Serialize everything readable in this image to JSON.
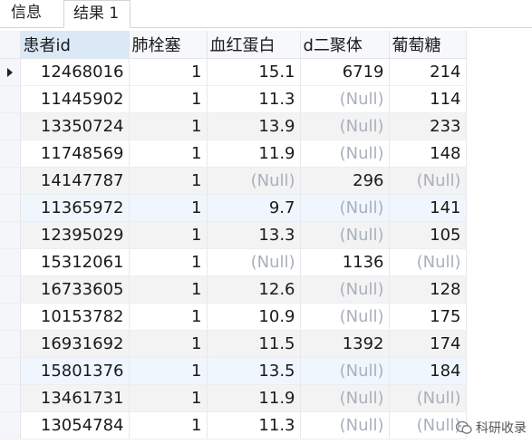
{
  "tabs": [
    "信息",
    "结果 1"
  ],
  "columns": [
    "患者id",
    "肺栓塞",
    "血红蛋白",
    "d二聚体",
    "葡萄糖"
  ],
  "rows": [
    [
      "12468016",
      "1",
      "15.1",
      "6719",
      "214"
    ],
    [
      "11445902",
      "1",
      "11.3",
      "(Null)",
      "114"
    ],
    [
      "13350724",
      "1",
      "13.9",
      "(Null)",
      "233"
    ],
    [
      "11748569",
      "1",
      "11.9",
      "(Null)",
      "148"
    ],
    [
      "14147787",
      "1",
      "(Null)",
      "296",
      "(Null)"
    ],
    [
      "11365972",
      "1",
      "9.7",
      "(Null)",
      "141"
    ],
    [
      "12395029",
      "1",
      "13.3",
      "(Null)",
      "105"
    ],
    [
      "15312061",
      "1",
      "(Null)",
      "1136",
      "(Null)"
    ],
    [
      "16733605",
      "1",
      "12.6",
      "(Null)",
      "128"
    ],
    [
      "10153782",
      "1",
      "10.9",
      "(Null)",
      "175"
    ],
    [
      "16931692",
      "1",
      "11.5",
      "1392",
      "174"
    ],
    [
      "15801376",
      "1",
      "13.5",
      "(Null)",
      "184"
    ],
    [
      "13461731",
      "1",
      "11.9",
      "(Null)",
      "(Null)"
    ],
    [
      "13054784",
      "1",
      "11.3",
      "(Null)",
      "(Null)"
    ]
  ],
  "watermark": "科研收录",
  "colors": {
    "null_text": "#a9b0bc",
    "selected_header": "#dbe9f7"
  }
}
